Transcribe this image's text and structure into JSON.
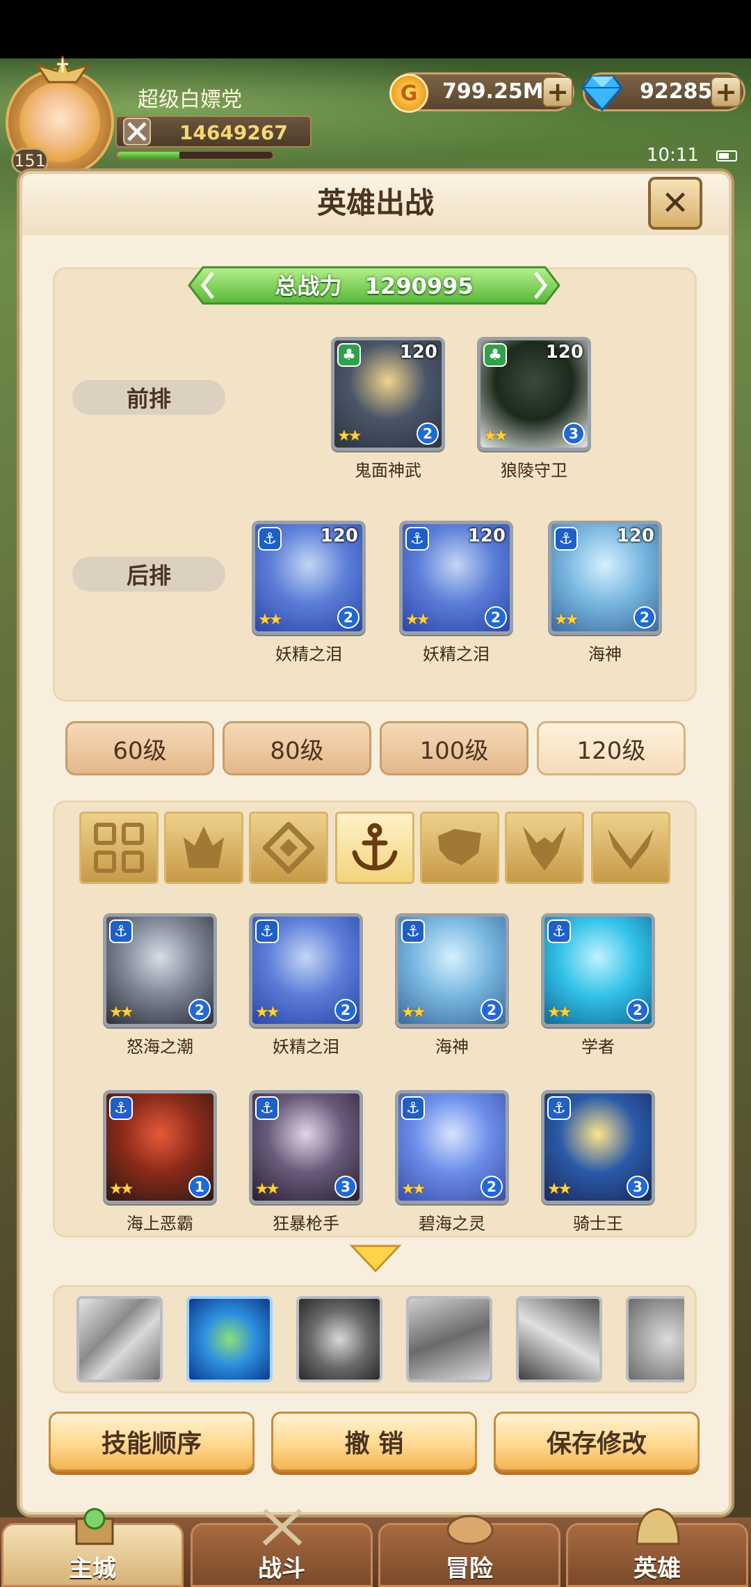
{
  "player": {
    "name": "超级白嫖党",
    "level": "151",
    "power": "14649267",
    "xp_fraction": 0.4
  },
  "currency": {
    "gold": "799.25M",
    "gems": "92285",
    "plus": "+"
  },
  "status": {
    "time": "10:11"
  },
  "dialog": {
    "title": "英雄出战",
    "close": "✕"
  },
  "formation": {
    "total_power_label": "总战力",
    "total_power_value": "1290995",
    "front_label": "前排",
    "back_label": "后排",
    "front": [
      {
        "name": "鬼面神武",
        "level": "120",
        "stars": "★★",
        "tier": "2",
        "type": "green"
      },
      {
        "name": "狼陵守卫",
        "level": "120",
        "stars": "★★",
        "tier": "3",
        "type": "green"
      }
    ],
    "back": [
      {
        "name": "妖精之泪",
        "level": "120",
        "stars": "★★",
        "tier": "2",
        "type": "blue"
      },
      {
        "name": "妖精之泪",
        "level": "120",
        "stars": "★★",
        "tier": "2",
        "type": "blue"
      },
      {
        "name": "海神",
        "level": "120",
        "stars": "★★",
        "tier": "2",
        "type": "blue"
      }
    ]
  },
  "level_tabs": [
    "60级",
    "80级",
    "100级",
    "120级"
  ],
  "faction_tabs": [
    "all",
    "flame",
    "diamond",
    "anchor",
    "beast",
    "horns",
    "wings"
  ],
  "roster": [
    {
      "name": "怒海之潮",
      "stars": "★★",
      "tier": "2"
    },
    {
      "name": "妖精之泪",
      "stars": "★★",
      "tier": "2"
    },
    {
      "name": "海神",
      "stars": "★★",
      "tier": "2"
    },
    {
      "name": "学者",
      "stars": "★★",
      "tier": "2"
    },
    {
      "name": "海上恶霸",
      "stars": "★★",
      "tier": "1"
    },
    {
      "name": "狂暴枪手",
      "stars": "★★",
      "tier": "3"
    },
    {
      "name": "碧海之灵",
      "stars": "★★",
      "tier": "2"
    },
    {
      "name": "骑士王",
      "stars": "★★",
      "tier": "3"
    }
  ],
  "buttons": {
    "skill_order": "技能顺序",
    "cancel": "撤 销",
    "save": "保存修改"
  },
  "nav": [
    "主城",
    "战斗",
    "冒险",
    "英雄"
  ]
}
